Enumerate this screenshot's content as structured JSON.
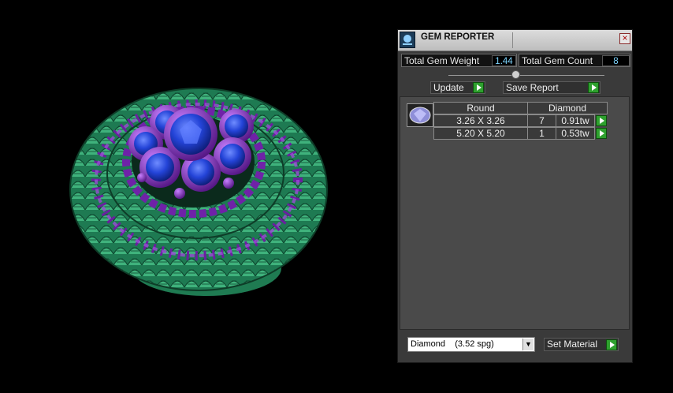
{
  "panel": {
    "title": "GEM REPORTER",
    "total_weight_label": "Total Gem Weight",
    "total_weight_value": "1.44",
    "total_count_label": "Total Gem Count",
    "total_count_value": "8",
    "update_label": "Update",
    "save_report_label": "Save Report",
    "table": {
      "header_shape": "Round",
      "header_material": "Diamond",
      "rows": [
        {
          "size": "3.26 X 3.26",
          "count": "7",
          "weight": "0.91tw"
        },
        {
          "size": "5.20 X 5.20",
          "count": "1",
          "weight": "0.53tw"
        }
      ]
    },
    "material_select": "Diamond    (3.52 spg)",
    "set_material_label": "Set Material"
  },
  "colors": {
    "accent_green": "#2ea02e",
    "value_cyan": "#7fd6ff",
    "ring_green": "#2f9a6a",
    "ring_purple": "#7a2bb0",
    "gem_blue": "#1f3fbf"
  },
  "icons": [
    "gem-reporter-app-icon",
    "close-icon",
    "play-arrow-icon",
    "gem-round-diamond-icon",
    "chevron-down-icon"
  ]
}
